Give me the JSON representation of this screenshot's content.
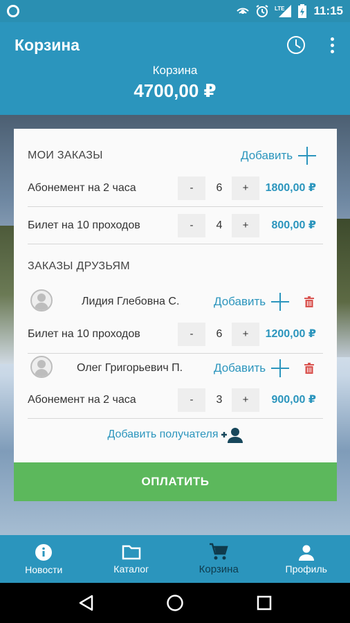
{
  "status_bar": {
    "time": "11:15",
    "network": "LTE"
  },
  "header": {
    "title": "Корзина",
    "caption": "Корзина",
    "total": "4700,00 ₽"
  },
  "my_orders": {
    "title": "МОИ ЗАКАЗЫ",
    "add_label": "Добавить",
    "items": [
      {
        "name": "Абонемент на 2 часа",
        "qty": "6",
        "price": "1800,00 ₽"
      },
      {
        "name": "Билет на 10 проходов",
        "qty": "4",
        "price": "800,00 ₽"
      }
    ]
  },
  "friend_orders": {
    "title": "ЗАКАЗЫ ДРУЗЬЯМ",
    "friends": [
      {
        "name": "Лидия Глебовна С.",
        "add_label": "Добавить",
        "item": {
          "name": "Билет на 10 проходов",
          "qty": "6",
          "price": "1200,00 ₽"
        }
      },
      {
        "name": "Олег Григорьевич П.",
        "add_label": "Добавить",
        "item": {
          "name": "Абонемент на 2 часа",
          "qty": "3",
          "price": "900,00 ₽"
        }
      }
    ],
    "add_recipient": "Добавить получателя"
  },
  "qty_controls": {
    "minus": "-",
    "plus": "+"
  },
  "pay_button": "ОПЛАТИТЬ",
  "bottom_nav": [
    {
      "label": "Новости",
      "icon": "info-icon"
    },
    {
      "label": "Каталог",
      "icon": "folder-icon"
    },
    {
      "label": "Корзина",
      "icon": "cart-icon",
      "active": true
    },
    {
      "label": "Профиль",
      "icon": "person-icon"
    }
  ],
  "colors": {
    "primary": "#2b95bd",
    "status_bar": "#2a8fb2",
    "pay": "#5cb85c",
    "delete": "#d9534f",
    "active_nav": "#0f3b4d"
  }
}
